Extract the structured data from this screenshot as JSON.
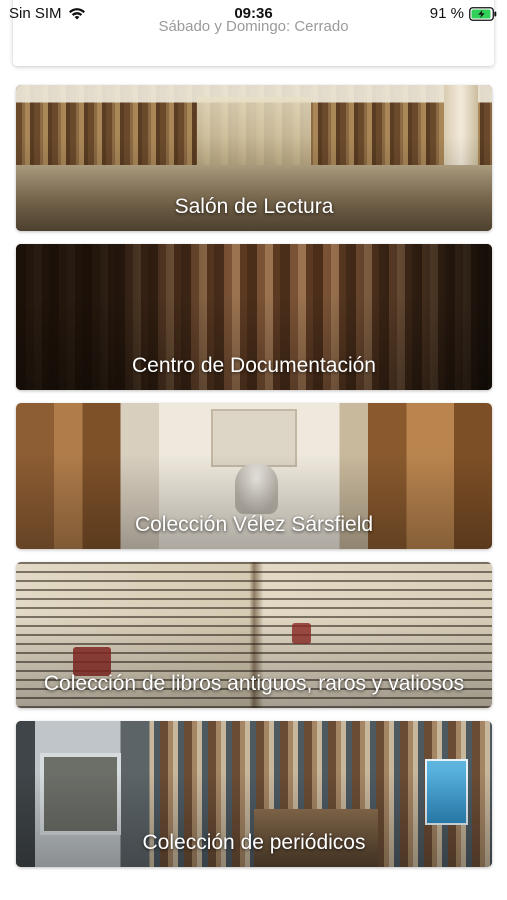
{
  "status_bar": {
    "carrier": "Sin SIM",
    "time": "09:36",
    "battery_percent": "91 %",
    "wifi_icon": "wifi-icon",
    "battery_icon": "battery-charging-icon"
  },
  "hours_card": {
    "text": "Sábado y Domingo: Cerrado"
  },
  "collections": [
    {
      "label": "Salón de Lectura"
    },
    {
      "label": "Centro de Documentación"
    },
    {
      "label": "Colección Vélez Sársfield"
    },
    {
      "label": "Colección de libros antiguos, raros y valiosos"
    },
    {
      "label": "Colección de periódicos"
    }
  ],
  "colors": {
    "battery_fill": "#30d158",
    "label_text": "#ffffff",
    "muted_text": "#9a9a9a"
  }
}
